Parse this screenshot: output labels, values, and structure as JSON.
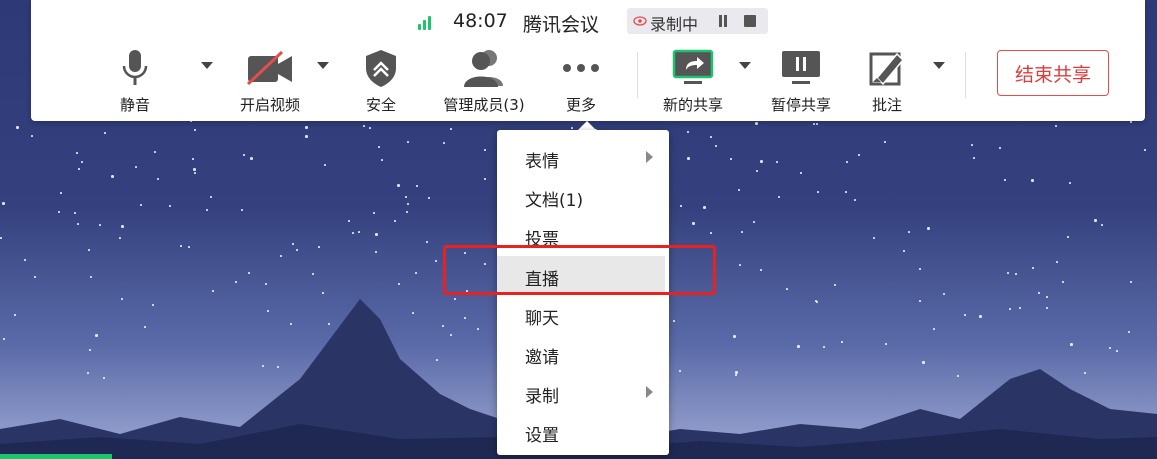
{
  "status": {
    "time": "48:07",
    "title": "腾讯会议",
    "recording_label": "录制中"
  },
  "toolbar": {
    "mute_label": "静音",
    "video_label": "开启视频",
    "security_label": "安全",
    "members_label": "管理成员(3)",
    "more_label": "更多",
    "new_share_label": "新的共享",
    "pause_share_label": "暂停共享",
    "annotate_label": "批注",
    "end_share_label": "结束共享"
  },
  "menu": {
    "items": [
      {
        "label": "表情"
      },
      {
        "label": "文档(1)"
      },
      {
        "label": "投票"
      },
      {
        "label": "直播"
      },
      {
        "label": "聊天"
      },
      {
        "label": "邀请"
      },
      {
        "label": "录制"
      },
      {
        "label": "设置"
      }
    ]
  },
  "colors": {
    "accent_green": "#1ec46b",
    "end_red": "#e03b3b",
    "highlight_red": "#e8231f"
  }
}
